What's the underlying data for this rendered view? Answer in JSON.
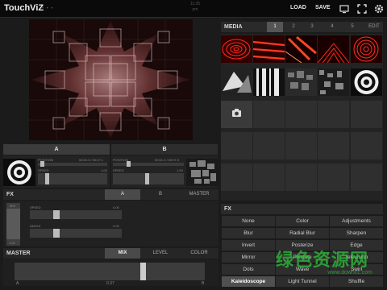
{
  "app": {
    "title": "TouchViZ",
    "dots": "• • •",
    "clock_time": "11:25",
    "clock_sub": "pm"
  },
  "toolbar": {
    "load_label": "LOAD",
    "save_label": "SAVE"
  },
  "deck_a": {
    "label": "A",
    "position_label": "POSITION",
    "position_value": "00:00.3 / 00:07.1",
    "speed_label": "SPEED",
    "speed_value": "1.00"
  },
  "deck_b": {
    "label": "B",
    "position_label": "POSITION",
    "position_value": "00:01.0 / 00:07.3",
    "speed_label": "SPEED",
    "speed_value": "1.00"
  },
  "fx_row": {
    "label": "FX",
    "tabs": [
      "A",
      "B",
      "MASTER"
    ],
    "active_tab": "A"
  },
  "fx_params": {
    "mix_label": "MIX",
    "mix_value": "1.00",
    "speed_label": "SPEED",
    "speed_value": "0.00",
    "angle_label": "ANGLE",
    "angle_value": "0.00"
  },
  "master": {
    "label": "MASTER",
    "tabs": [
      "MIX",
      "LEVEL",
      "COLOR"
    ],
    "active_tab": "MIX",
    "left_label": "A",
    "right_label": "B",
    "crossfade_value": "0.37"
  },
  "media": {
    "label": "MEDIA",
    "banks": [
      "1",
      "2",
      "3",
      "4",
      "5"
    ],
    "active_bank": "1",
    "edit_label": "EDIT",
    "add_icon": "camera-icon"
  },
  "fx_panel": {
    "label": "FX",
    "grid": [
      [
        "None",
        "Color",
        "Adjustments"
      ],
      [
        "Blur",
        "Radial Blur",
        "Sharpen"
      ],
      [
        "Invert",
        "Posterize",
        "Edge"
      ],
      [
        "Mirror",
        "Pixelate",
        "Television"
      ],
      [
        "Dots",
        "Wave",
        "Swirl"
      ],
      [
        "Kaleidoscope",
        "Light Tunnel",
        "Shuffle"
      ]
    ],
    "active": "Kaleidoscope"
  },
  "watermark": {
    "text": "绿色资源网",
    "url": "www.downcc.com"
  }
}
